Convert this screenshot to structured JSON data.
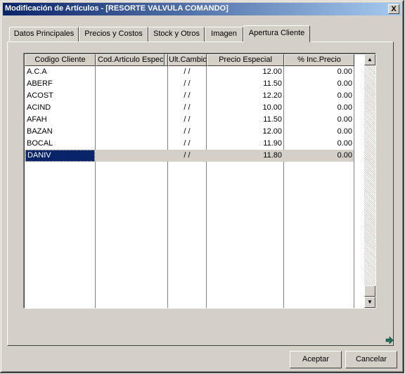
{
  "window": {
    "title": "Modificación de Artículos - [RESORTE VALVULA COMANDO]",
    "close_label": "X"
  },
  "tabs": [
    {
      "label": "Datos Principales",
      "active": false
    },
    {
      "label": "Precios y Costos",
      "active": false
    },
    {
      "label": "Stock y Otros",
      "active": false
    },
    {
      "label": "Imagen",
      "active": false
    },
    {
      "label": "Apertura Cliente",
      "active": true
    }
  ],
  "grid": {
    "columns": [
      "Codigo Cliente",
      "Cod.Articulo Especial",
      "Ult.Cambio",
      "Precio Especial",
      "% Inc.Precio"
    ],
    "rows": [
      {
        "codigo": "A.C.A",
        "cod_art": "",
        "ult_cambio": "/ /",
        "precio": "12.00",
        "inc": "0.00"
      },
      {
        "codigo": "ABERF",
        "cod_art": "",
        "ult_cambio": "/ /",
        "precio": "11.50",
        "inc": "0.00"
      },
      {
        "codigo": "ACOST",
        "cod_art": "",
        "ult_cambio": "/ /",
        "precio": "12.20",
        "inc": "0.00"
      },
      {
        "codigo": "ACIND",
        "cod_art": "",
        "ult_cambio": "/ /",
        "precio": "10.00",
        "inc": "0.00"
      },
      {
        "codigo": "AFAH",
        "cod_art": "",
        "ult_cambio": "/ /",
        "precio": "11.50",
        "inc": "0.00"
      },
      {
        "codigo": "BAZAN",
        "cod_art": "",
        "ult_cambio": "/ /",
        "precio": "12.00",
        "inc": "0.00"
      },
      {
        "codigo": "BOCAL",
        "cod_art": "",
        "ult_cambio": "/ /",
        "precio": "11.90",
        "inc": "0.00"
      },
      {
        "codigo": "DANIV",
        "cod_art": "",
        "ult_cambio": "/ /",
        "precio": "11.80",
        "inc": "0.00",
        "selected": true
      }
    ]
  },
  "buttons": {
    "accept": "Aceptar",
    "cancel": "Cancelar"
  },
  "icons": {
    "next": "arrow-right-icon",
    "scroll_up": "scroll-up-arrow-icon",
    "scroll_down": "scroll-down-arrow-icon",
    "close": "close-icon"
  },
  "colors": {
    "titlebar_start": "#0a246a",
    "titlebar_end": "#a6caf0",
    "selection": "#0a246a",
    "face": "#d4d0c8",
    "next_arrow": "#1f6f5a"
  }
}
